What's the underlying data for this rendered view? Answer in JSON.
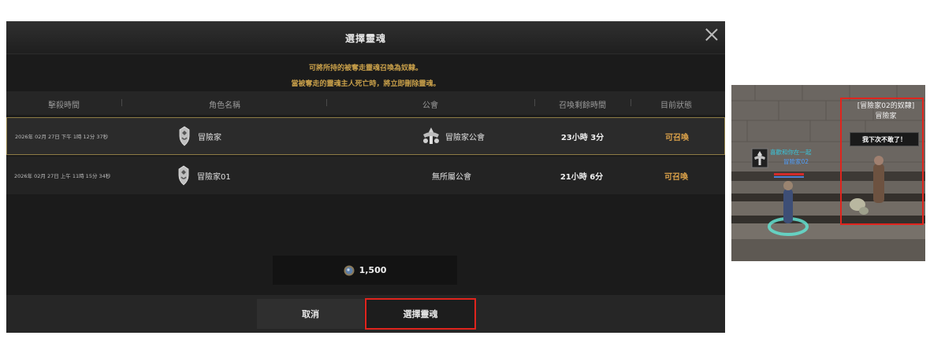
{
  "dialog": {
    "title": "選擇靈魂",
    "notice_line1": "可將所持的被奪走靈魂召喚為奴隸。",
    "notice_line2": "當被奪走的靈魂主人死亡時，將立即刪除靈魂。",
    "columns": [
      "擊殺時間",
      "角色名稱",
      "公會",
      "召喚剩餘時間",
      "目前狀態"
    ],
    "rows": [
      {
        "time": "2026年 02月 27日 下午 1時 12分 37秒",
        "character": "冒險家",
        "guild": "冒險家公會",
        "remaining": "23小時 3分",
        "status": "可召喚",
        "selected": true
      },
      {
        "time": "2026年 02月 27日 上午 11時 15分 34秒",
        "character": "冒險家01",
        "guild": "無所屬公會",
        "remaining": "21小時 6分",
        "status": "可召喚",
        "selected": false
      }
    ],
    "cost": "1,500",
    "cancel_label": "取消",
    "confirm_label": "選擇靈魂"
  },
  "scene": {
    "owner_guild_name": "喜歡和你在一起",
    "owner_name": "冒險家02",
    "slave_tag": "[冒險家02的奴隸]",
    "slave_name": "冒險家",
    "speech": "我下次不敢了！"
  },
  "colors": {
    "accent_gold": "#c9a04a",
    "status_orange": "#d9a049",
    "highlight_red": "#e0241d"
  },
  "icons": [
    "close-icon",
    "character-crest-icon",
    "guild-crest-icon",
    "coin-icon"
  ]
}
